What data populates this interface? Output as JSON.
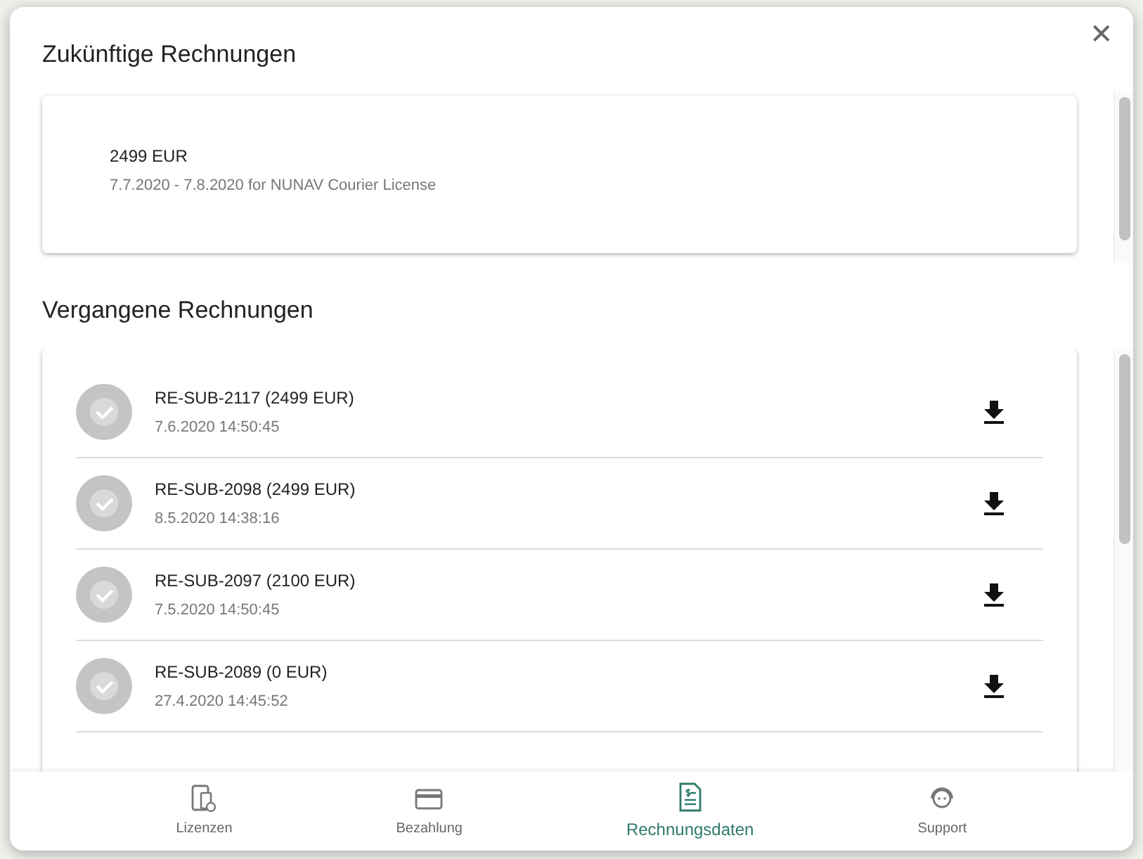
{
  "dialog": {
    "close_symbol": "✕"
  },
  "upcoming": {
    "title": "Zukünftige Rechnungen",
    "amount": "2499 EUR",
    "description": "7.7.2020 - 7.8.2020 for NUNAV Courier License"
  },
  "past": {
    "title": "Vergangene Rechnungen",
    "invoices": [
      {
        "title": "RE-SUB-2117 (2499 EUR)",
        "date": "7.6.2020 14:50:45"
      },
      {
        "title": "RE-SUB-2098 (2499 EUR)",
        "date": "8.5.2020 14:38:16"
      },
      {
        "title": "RE-SUB-2097 (2100 EUR)",
        "date": "7.5.2020 14:50:45"
      },
      {
        "title": "RE-SUB-2089 (0 EUR)",
        "date": "27.4.2020 14:45:52"
      }
    ]
  },
  "bottom_nav": [
    {
      "kind": "licenses",
      "label": "Lizenzen",
      "selected": false
    },
    {
      "kind": "payment",
      "label": "Bezahlung",
      "selected": false
    },
    {
      "kind": "invoice",
      "label": "Rechnungsdaten",
      "selected": true
    },
    {
      "kind": "support",
      "label": "Support",
      "selected": false
    }
  ]
}
